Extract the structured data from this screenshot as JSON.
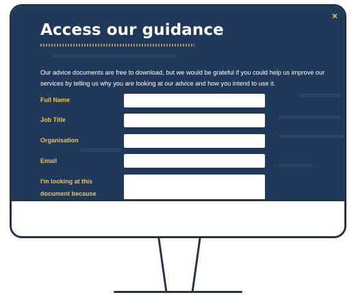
{
  "modal": {
    "close_symbol": "×",
    "title": "Access our guidance",
    "intro": "Our advice documents are free to download, but we would be grateful if you could help us improve our services by telling us why you are looking at our advice and how you intend to use it."
  },
  "form": {
    "full_name_label": "Full Name",
    "job_title_label": "Job Title",
    "organisation_label": "Organisation",
    "email_label": "Email",
    "reason_label_line1": "I'm looking at this",
    "reason_label_line2": "document because"
  },
  "colors": {
    "screen_background": "#20385a",
    "accent": "#f0c23a",
    "frame": "#253349"
  },
  "icons": {
    "close": "close-icon"
  }
}
